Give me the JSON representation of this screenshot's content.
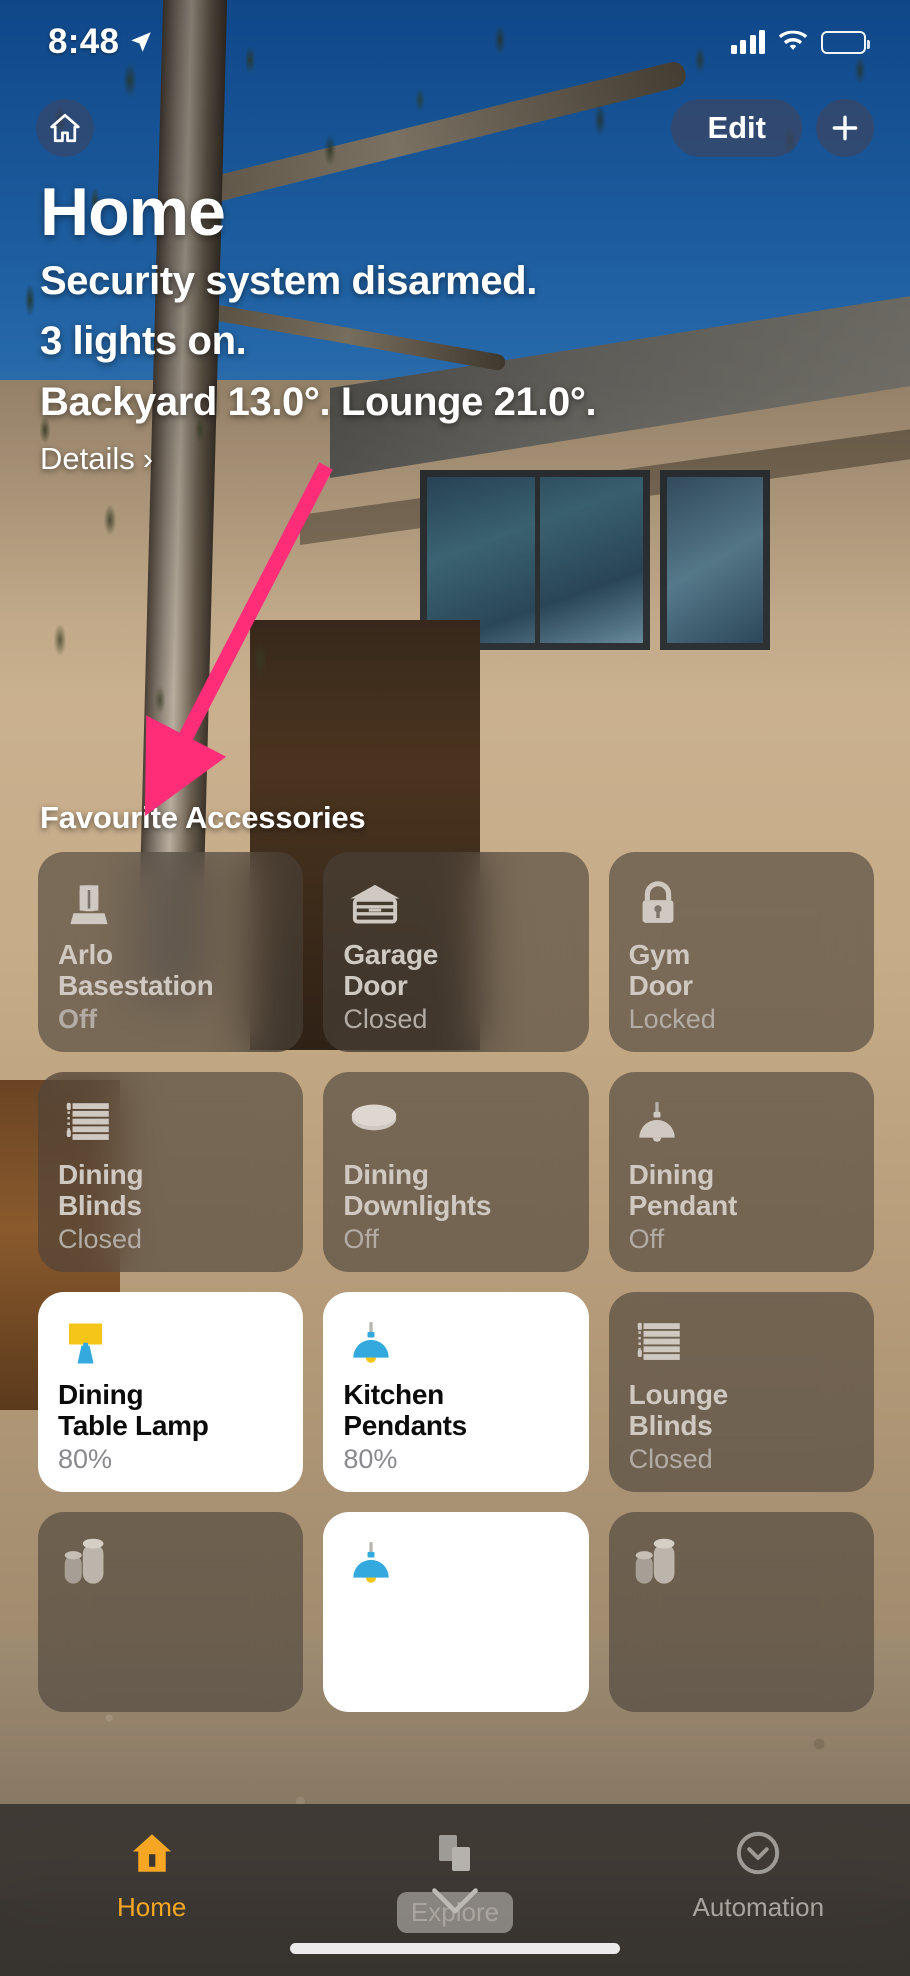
{
  "status_bar": {
    "time": "8:48",
    "location_icon": "location-arrow-icon",
    "signal_icon": "cellular-signal-icon",
    "wifi_icon": "wifi-icon",
    "battery_icon": "battery-low-icon",
    "battery_color": "#f5c518"
  },
  "nav": {
    "home_badge_icon": "house-icon",
    "edit_label": "Edit",
    "add_label": "+"
  },
  "header": {
    "title": "Home",
    "status_lines": [
      "Security system disarmed.",
      "3 lights on.",
      "Backyard 13.0°. Lounge 21.0°."
    ],
    "details_label": "Details",
    "details_chevron": "›"
  },
  "accessories": {
    "section_title": "Favourite Accessories",
    "tiles": [
      {
        "name": "Arlo\nBasestation",
        "state": "Off",
        "icon": "basestation-icon",
        "on": false,
        "alert": true
      },
      {
        "name": "Garage\nDoor",
        "state": "Closed",
        "icon": "garage-door-icon",
        "on": false,
        "alert": false
      },
      {
        "name": "Gym\nDoor",
        "state": "Locked",
        "icon": "lock-icon",
        "on": false,
        "alert": false
      },
      {
        "name": "Dining\nBlinds",
        "state": "Closed",
        "icon": "blinds-icon",
        "on": false,
        "alert": false
      },
      {
        "name": "Dining\nDownlights",
        "state": "Off",
        "icon": "downlight-icon",
        "on": false,
        "alert": false
      },
      {
        "name": "Dining\nPendant",
        "state": "Off",
        "icon": "pendant-icon",
        "on": false,
        "alert": false
      },
      {
        "name": "Dining\nTable Lamp",
        "state": "80%",
        "icon": "table-lamp-icon",
        "on": true,
        "alert": false
      },
      {
        "name": "Kitchen\nPendants",
        "state": "80%",
        "icon": "pendant-icon",
        "on": true,
        "alert": false
      },
      {
        "name": "Lounge\nBlinds",
        "state": "Closed",
        "icon": "blinds-icon",
        "on": false,
        "alert": false
      },
      {
        "name": "",
        "state": "",
        "icon": "speaker-icon",
        "on": false,
        "alert": false
      },
      {
        "name": "",
        "state": "",
        "icon": "pendant-icon",
        "on": true,
        "alert": false
      },
      {
        "name": "",
        "state": "",
        "icon": "speaker-icon",
        "on": false,
        "alert": false
      }
    ]
  },
  "tabbar": {
    "tabs": [
      {
        "label": "Home",
        "icon": "house-filled-icon",
        "active": true
      },
      {
        "label": "Explore",
        "icon": "explore-squares-icon",
        "active": false
      },
      {
        "label": "Automation",
        "icon": "automation-chevron-circle-icon",
        "active": false
      }
    ],
    "active_color": "#f5a623",
    "inactive_color": "#a9a49e"
  },
  "annotation": {
    "arrow_color": "#ff2d78",
    "arrow_target": "Arlo Basestation tile"
  }
}
